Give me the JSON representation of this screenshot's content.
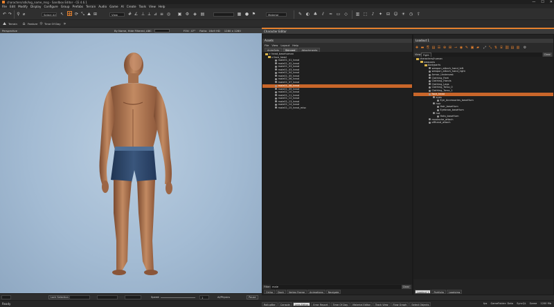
{
  "app": {
    "title": "characters/sdk/log_name_msg - Sandbox Editor - CE 4.6.1",
    "controls": [
      "—",
      "☐",
      "✕"
    ]
  },
  "menu": [
    "File",
    "Edit",
    "Modify",
    "Display",
    "Configure",
    "Group",
    "Prefabs",
    "Terrain",
    "Audio",
    "Game",
    "AI",
    "Create",
    "Tools",
    "View",
    "Help"
  ],
  "toolbar": {
    "select_mode": "Select All",
    "view_mode": "View",
    "material": "Material"
  },
  "toolbar2": {
    "terrain": "Terrain",
    "feature": "Feature",
    "time_of_day": "Time Of Day"
  },
  "viewport": {
    "title": "Perspective",
    "filter": "By Name, Hide Filtered, ABC",
    "fov_label": "FOV:",
    "fov": "47°",
    "ratio_label": "Ratio:",
    "ratio": "16x9 HD",
    "resolution": "1280 x 1280"
  },
  "viewport_bottom": {
    "lock_selection": "Lock Selection",
    "speed_label": "Speed:",
    "speed": "1",
    "ai_physics": "AI/Physics",
    "pause": "Pause"
  },
  "right_header": {
    "title": "Character Editor"
  },
  "assets_panel": {
    "title": "Assets",
    "menu": [
      "File",
      "View",
      "Layout",
      "Help"
    ],
    "tabs": [
      "AnimSets",
      "Skinned",
      "Attachments"
    ],
    "filter_label": "Filter:",
    "filter_value": "male",
    "clear": "Clear",
    "items": [
      "> head_basehuman",
      "v face_head",
      "male01_01_head",
      "male01_02_head",
      "male01_03_head",
      "male01_03_head",
      "male01_04_head",
      "male01_05_head",
      "male01_06_head",
      "male01_07_head",
      "male01_08_head",
      "male01_09_head",
      "male01_10_head",
      "male01_11_head",
      "male01_12_head",
      "male01_13_head",
      "male01_14_head",
      "male01_15_head_misc"
    ],
    "selected_index": 10
  },
  "lowerleft_tabs": [
    "Ortho",
    "Dock",
    "Vertex Frame",
    "Animations",
    "Navigate"
  ],
  "loadout_panel": {
    "title": "Loadout 1",
    "filter_label": "View",
    "filter_value": "Fight",
    "clear": "Clear",
    "items": [
      {
        "label": "characters/human",
        "indent": 0
      },
      {
        "label": "weapons",
        "indent": 1
      },
      {
        "label": "bodyparts",
        "indent": 2
      },
      {
        "label": "weapon_attach_hand_left",
        "indent": 3
      },
      {
        "label": "weapon_attach_hand_right",
        "indent": 3
      },
      {
        "label": "Armor_Undervest",
        "indent": 3
      },
      {
        "label": "Clothing_Feet",
        "indent": 3
      },
      {
        "label": "Clothing_Hands",
        "indent": 3
      },
      {
        "label": "Clothing_Legs",
        "indent": 3
      },
      {
        "label": "Clothing_Torso_0",
        "indent": 3
      },
      {
        "label": "Clothing_Torso_1",
        "indent": 3
      },
      {
        "label": "face_head",
        "indent": 3
      },
      {
        "label": "eyes",
        "indent": 4
      },
      {
        "label": "Eye_Accessories_baseHum",
        "indent": 5
      },
      {
        "label": "hair",
        "indent": 4
      },
      {
        "label": "Hair_baseHum",
        "indent": 5
      },
      {
        "label": "Eyebrow_baseHum",
        "indent": 5
      },
      {
        "label": "hat",
        "indent": 4
      },
      {
        "label": "Hats_baseHum",
        "indent": 5
      },
      {
        "label": "mustache_attach",
        "indent": 3
      },
      {
        "label": "offhand_attach",
        "indent": 3
      }
    ],
    "selected_index": 11,
    "bottom_tabs": [
      "Loadout 1",
      "Portfolio",
      "Loadview"
    ]
  },
  "status": {
    "ready": "Ready",
    "bottom_tabs": [
      "RollupBar",
      "Console",
      "Lens Editor",
      "Error Report",
      "Time Of Day",
      "Material Editor",
      "Track View",
      "Flow Graph",
      "Select Objects"
    ],
    "active_bottom_tab": 2,
    "right_info": [
      "fps",
      "GameFolder: Data",
      "SyncQL",
      "Game",
      "1200 Mb"
    ]
  },
  "colors": {
    "accent": "#e8822e",
    "selection": "#c9662a",
    "panel_bg": "#232323"
  }
}
